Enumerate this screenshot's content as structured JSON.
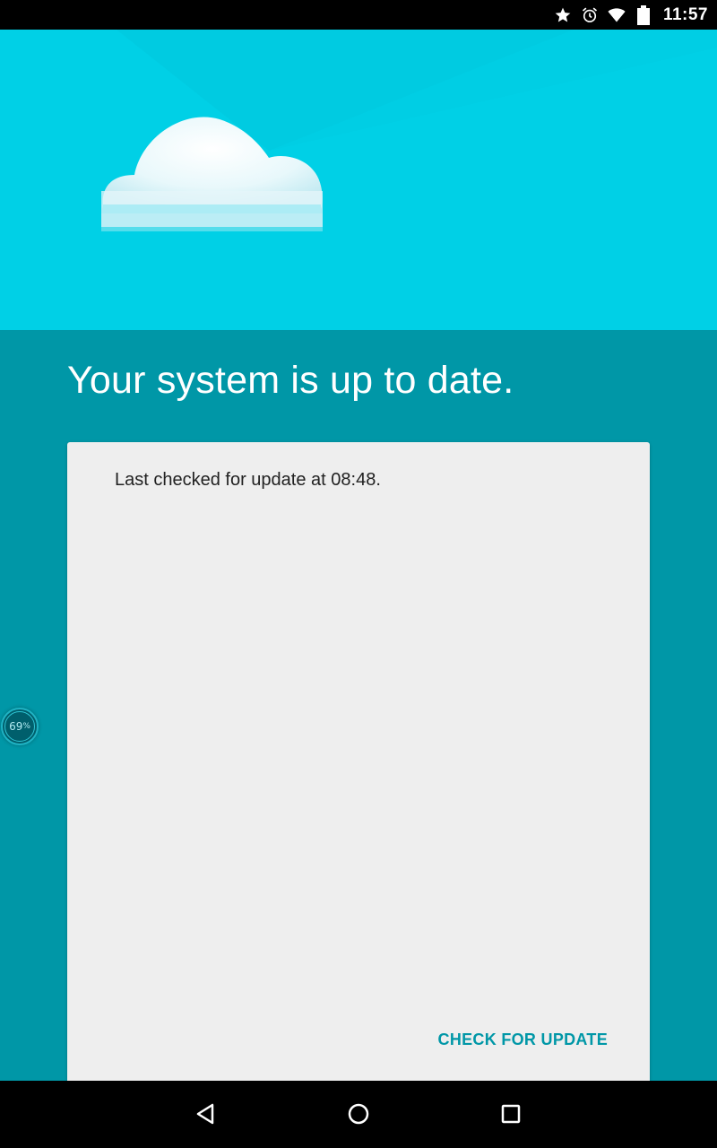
{
  "status_bar": {
    "time": "11:57",
    "icons": [
      "star-icon",
      "alarm-icon",
      "wifi-icon",
      "battery-icon"
    ]
  },
  "main": {
    "headline": "Your system is up to date.",
    "card": {
      "last_checked": "Last checked for update at 08:48.",
      "check_button_label": "CHECK FOR UPDATE"
    }
  },
  "battery_widget": {
    "value": "69",
    "unit": "%"
  },
  "nav_bar": {
    "buttons": [
      "back-icon",
      "home-icon",
      "recents-icon"
    ]
  },
  "colors": {
    "header_background": "#00d0e6",
    "body_background": "#0097a7",
    "card_background": "#eeeeee",
    "accent": "#0097a7"
  }
}
